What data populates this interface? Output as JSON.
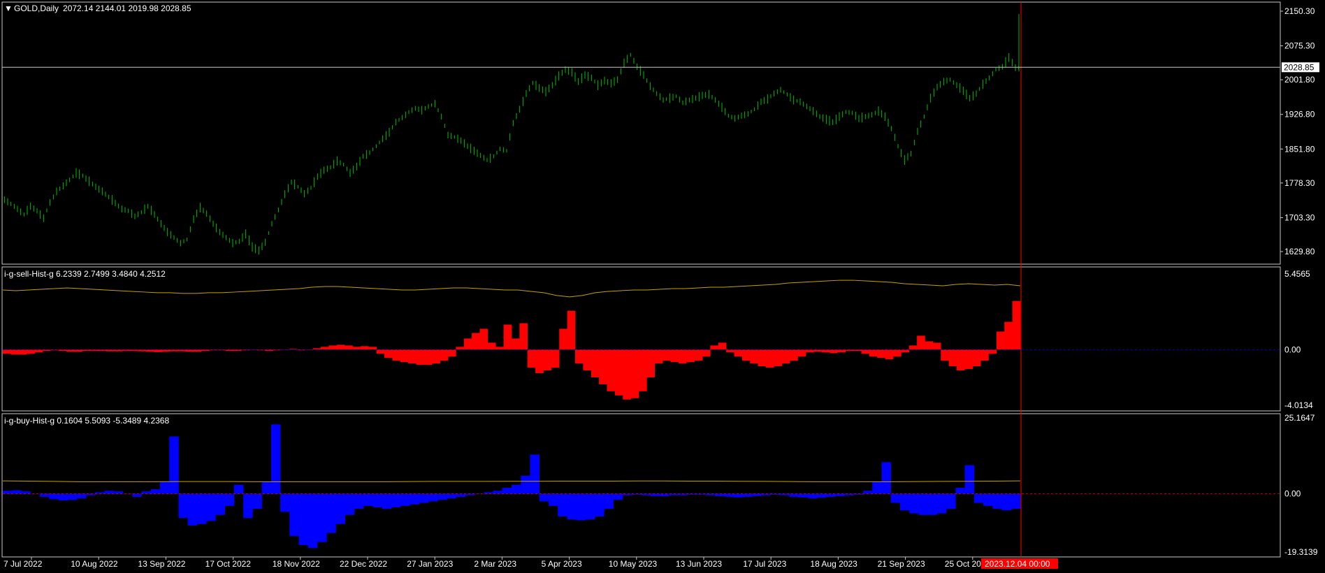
{
  "main": {
    "symbol": "GOLD,Daily",
    "ohlc": "2072.14 2144.01 2019.98 2028.85",
    "price_ticks": [
      "2150.30",
      "2075.30",
      "2001.80",
      "1926.80",
      "1851.80",
      "1778.30",
      "1703.30",
      "1629.80"
    ],
    "current_price": "2028.85",
    "colors": {
      "candle": "#00c000",
      "grid_line": "#c0c0c0",
      "current_line": "#c0c0c0"
    }
  },
  "sell_panel": {
    "name": "i-g-sell-Hist-g 6.2339 2.7499 3.4840 4.2512",
    "ticks": [
      "5.4565",
      "0.00",
      "-4.0134"
    ],
    "colors": {
      "hist": "#ff0000",
      "signal": "#c8a000",
      "zero": "#0000c0"
    }
  },
  "buy_panel": {
    "name": "i-g-buy-Hist-g 0.1604 5.5093 -5.3489 4.2368",
    "ticks": [
      "25.1647",
      "0.00",
      "-19.3139"
    ],
    "colors": {
      "hist": "#0000ff",
      "signal": "#c8a000",
      "zero": "#c00000"
    }
  },
  "time_axis": {
    "labels": [
      "7 Jul 2022",
      "10 Aug 2022",
      "13 Sep 2022",
      "17 Oct 2022",
      "18 Nov 2022",
      "22 Dec 2022",
      "27 Jan 2023",
      "2 Mar 2023",
      "5 Apr 2023",
      "10 May 2023",
      "13 Jun 2023",
      "17 Jul 2023",
      "18 Aug 2023",
      "21 Sep 2023",
      "25 Oct 2023"
    ],
    "crosshair_label": "2023.12.04 00:00",
    "crosshair_color": "#ff0000"
  },
  "chart_data": [
    {
      "type": "ohlc",
      "title": "GOLD,Daily",
      "x_range": [
        "7 Jul 2022",
        "2023.12.04"
      ],
      "ylim": [
        1629.8,
        2150.3
      ],
      "series": [
        {
          "values": [
            1742,
            1733,
            1722,
            1710,
            1728,
            1718,
            1702,
            1736,
            1760,
            1772,
            1785,
            1800,
            1794,
            1782,
            1770,
            1760,
            1748,
            1735,
            1722,
            1718,
            1706,
            1715,
            1728,
            1710,
            1690,
            1672,
            1660,
            1648,
            1656,
            1700,
            1725,
            1712,
            1690,
            1672,
            1660,
            1648,
            1652,
            1668,
            1640,
            1632,
            1650,
            1690,
            1720,
            1754,
            1780,
            1770,
            1755,
            1768,
            1792,
            1806,
            1812,
            1826,
            1818,
            1800,
            1814,
            1836,
            1844,
            1858,
            1874,
            1888,
            1910,
            1920,
            1932,
            1940,
            1936,
            1944,
            1950,
            1922,
            1882,
            1878,
            1870,
            1858,
            1848,
            1838,
            1828,
            1836,
            1852,
            1848,
            1908,
            1938,
            1972,
            1995,
            1984,
            1976,
            1990,
            2010,
            2024,
            2018,
            1998,
            2012,
            2006,
            1990,
            2000,
            1994,
            2002,
            2038,
            2056,
            2030,
            2012,
            1988,
            1972,
            1958,
            1962,
            1966,
            1952,
            1958,
            1962,
            1968,
            1970,
            1958,
            1942,
            1924,
            1918,
            1924,
            1928,
            1938,
            1954,
            1960,
            1972,
            1980,
            1970,
            1958,
            1954,
            1944,
            1934,
            1922,
            1916,
            1910,
            1922,
            1932,
            1930,
            1918,
            1922,
            1926,
            1934,
            1922,
            1896,
            1858,
            1828,
            1842,
            1890,
            1922,
            1962,
            1986,
            1998,
            2002,
            1990,
            1978,
            1962,
            1972,
            1992,
            2006,
            2024,
            2030,
            2050,
            2028
          ]
        }
      ]
    },
    {
      "type": "bar",
      "title": "i-g-sell-Hist-g 6.2339 2.7499 3.4840 4.2512",
      "ylim": [
        -4.0134,
        5.4565
      ],
      "series": [
        {
          "name": "hist",
          "values": [
            -0.3,
            -0.35,
            -0.35,
            -0.3,
            -0.2,
            -0.1,
            -0.05,
            -0.1,
            -0.15,
            -0.15,
            -0.1,
            -0.1,
            -0.1,
            -0.12,
            -0.12,
            -0.1,
            -0.1,
            -0.12,
            -0.15,
            -0.18,
            -0.15,
            -0.12,
            -0.12,
            -0.15,
            -0.15,
            -0.1,
            -0.05,
            -0.05,
            -0.1,
            -0.1,
            -0.05,
            0.0,
            -0.05,
            -0.1,
            -0.05,
            0.0,
            0.05,
            -0.05,
            0.0,
            0.1,
            0.2,
            0.3,
            0.35,
            0.3,
            0.2,
            0.25,
            0.2,
            -0.3,
            -0.6,
            -0.8,
            -0.9,
            -1.0,
            -1.1,
            -1.1,
            -1.0,
            -0.8,
            -0.5,
            0.2,
            0.8,
            1.2,
            1.5,
            0.5,
            0.2,
            1.8,
            0.8,
            1.9,
            -1.3,
            -1.7,
            -1.5,
            -1.3,
            1.5,
            2.8,
            -1.0,
            -1.5,
            -2.0,
            -2.5,
            -3.0,
            -3.3,
            -3.6,
            -3.5,
            -3.0,
            -2.0,
            -1.0,
            -0.8,
            -0.9,
            -1.0,
            -0.9,
            -0.8,
            -0.5,
            0.3,
            0.5,
            -0.2,
            -0.5,
            -0.8,
            -1.0,
            -1.2,
            -1.3,
            -1.2,
            -1.0,
            -0.8,
            -0.5,
            -0.2,
            -0.15,
            -0.2,
            -0.25,
            -0.2,
            -0.1,
            -0.1,
            -0.3,
            -0.5,
            -0.6,
            -0.7,
            -0.5,
            -0.2,
            0.3,
            1.0,
            0.6,
            0.5,
            -0.8,
            -1.2,
            -1.5,
            -1.4,
            -1.2,
            -0.8,
            -0.3,
            1.3,
            2.0,
            3.5
          ]
        },
        {
          "name": "signal",
          "values": [
            4.3,
            4.25,
            4.3,
            4.35,
            4.4,
            4.45,
            4.4,
            4.35,
            4.3,
            4.25,
            4.2,
            4.15,
            4.1,
            4.1,
            4.05,
            4.05,
            4.1,
            4.1,
            4.15,
            4.2,
            4.25,
            4.3,
            4.35,
            4.4,
            4.5,
            4.55,
            4.55,
            4.5,
            4.45,
            4.4,
            4.35,
            4.3,
            4.3,
            4.35,
            4.4,
            4.45,
            4.45,
            4.4,
            4.35,
            4.3,
            4.3,
            4.2,
            4.1,
            3.9,
            3.8,
            3.9,
            4.1,
            4.2,
            4.25,
            4.3,
            4.3,
            4.35,
            4.4,
            4.4,
            4.45,
            4.5,
            4.5,
            4.55,
            4.6,
            4.65,
            4.7,
            4.8,
            4.85,
            4.9,
            4.95,
            5.0,
            5.0,
            4.95,
            4.9,
            4.85,
            4.75,
            4.7,
            4.65,
            4.6,
            4.7,
            4.75,
            4.7,
            4.65,
            4.7,
            4.6
          ]
        }
      ]
    },
    {
      "type": "bar",
      "title": "i-g-buy-Hist-g 0.1604 5.5093 -5.3489 4.2368",
      "ylim": [
        -19.3139,
        25.1647
      ],
      "series": [
        {
          "name": "hist",
          "values": [
            1.0,
            1.2,
            0.8,
            0.0,
            -1.0,
            -1.8,
            -2.2,
            -2.0,
            -1.5,
            -0.5,
            0.5,
            1.0,
            0.8,
            0.0,
            -1.0,
            0.8,
            1.5,
            4.0,
            19.0,
            -8.0,
            -10.5,
            -10.0,
            -9.0,
            -7.0,
            -4.0,
            3.0,
            -8.0,
            -5.0,
            4.0,
            23.0,
            -6.0,
            -14.0,
            -17.0,
            -18.0,
            -16.0,
            -13.0,
            -10.0,
            -7.0,
            -5.0,
            -4.0,
            -4.5,
            -5.0,
            -4.5,
            -4.0,
            -3.5,
            -3.0,
            -2.5,
            -2.0,
            -1.5,
            -1.0,
            -0.5,
            0.0,
            0.5,
            1.0,
            2.0,
            3.0,
            6.0,
            13.0,
            -2.5,
            -4.0,
            -7.5,
            -8.5,
            -8.8,
            -8.5,
            -7.5,
            -5.0,
            -2.0,
            -0.5,
            -0.3,
            -0.5,
            -0.8,
            -0.8,
            -0.5,
            -0.5,
            -0.3,
            -0.3,
            -0.5,
            -0.8,
            -1.0,
            -1.2,
            -1.0,
            -0.8,
            -0.5,
            -0.3,
            -0.5,
            -1.0,
            -1.2,
            -1.5,
            -1.3,
            -1.0,
            -0.8,
            -0.5,
            -0.3,
            1.0,
            4.0,
            10.5,
            -3.0,
            -5.5,
            -6.5,
            -7.0,
            -7.0,
            -6.5,
            -5.0,
            2.0,
            9.5,
            -3.0,
            -4.0,
            -5.0,
            -5.5,
            -5.0
          ]
        },
        {
          "name": "signal",
          "values": [
            4.3,
            4.2,
            4.1,
            4.0,
            4.0,
            4.0,
            4.0,
            4.05,
            4.05,
            4.05,
            4.0,
            4.0,
            4.0,
            4.0,
            4.0,
            4.0,
            4.05,
            4.1,
            4.1,
            4.1,
            4.15,
            4.15,
            4.2,
            4.2,
            4.2,
            4.25,
            4.25,
            4.2,
            4.2,
            4.15,
            4.1,
            4.05,
            4.0,
            4.0,
            4.0,
            4.0,
            4.05,
            4.1,
            4.15,
            4.2,
            4.3
          ]
        }
      ]
    }
  ]
}
